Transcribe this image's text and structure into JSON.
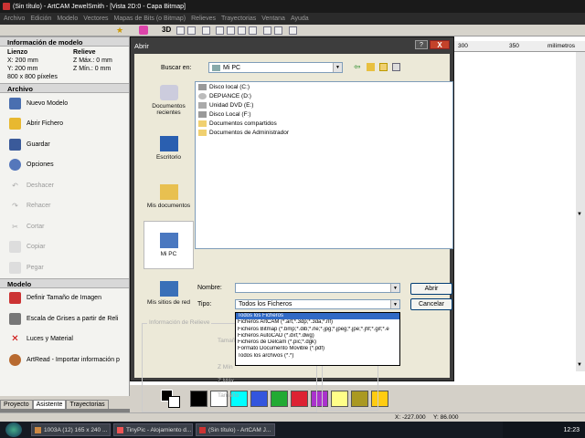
{
  "window": {
    "title": "(Sin título) - ArtCAM JewelSmith - [Vista 2D:0 - Capa Bitmap]"
  },
  "menu": [
    "Archivo",
    "Edición",
    "Modelo",
    "Vectores",
    "Mapas de Bits (o Bitmap)",
    "Relieves",
    "Trayectorias",
    "Ventana",
    "Ayuda"
  ],
  "toolbar": {
    "view3d": "3D"
  },
  "ruler": {
    "ticks": [
      "300",
      "350"
    ],
    "unit": "milímetros"
  },
  "panel": {
    "info_title": "Información de modelo",
    "lienzo_label": "Lienzo",
    "relieve_label": "Relieve",
    "x_size": "X: 200 mm",
    "y_size": "Y: 200 mm",
    "z_max": "Z Máx.: 0 mm",
    "z_min": "Z Mín.: 0 mm",
    "pixels": "800 x 800 píxeles",
    "archivo_title": "Archivo",
    "archivo_items": [
      {
        "label": "Nuevo Modelo",
        "enabled": true,
        "icon": "new-model-icon"
      },
      {
        "label": "Abrir Fichero",
        "enabled": true,
        "icon": "folder-open-icon"
      },
      {
        "label": "Guardar",
        "enabled": true,
        "icon": "save-icon"
      },
      {
        "label": "Opciones",
        "enabled": true,
        "icon": "options-icon"
      },
      {
        "label": "Deshacer",
        "enabled": false,
        "icon": "undo-icon"
      },
      {
        "label": "Rehacer",
        "enabled": false,
        "icon": "redo-icon"
      },
      {
        "label": "Cortar",
        "enabled": false,
        "icon": "cut-icon"
      },
      {
        "label": "Copiar",
        "enabled": false,
        "icon": "copy-icon"
      },
      {
        "label": "Pegar",
        "enabled": false,
        "icon": "paste-icon"
      }
    ],
    "modelo_title": "Modelo",
    "modelo_items": [
      {
        "label": "Definir Tamaño de Imagen",
        "icon": "image-size-icon"
      },
      {
        "label": "Escala de Grises a partir de Reli",
        "icon": "grayscale-icon"
      },
      {
        "label": "Luces y Material",
        "icon": "lights-icon"
      },
      {
        "label": "ArtRead - Importar información p",
        "icon": "artread-icon"
      }
    ],
    "tabs": [
      "Proyecto",
      "Asistente",
      "Trayectorias"
    ]
  },
  "dialog": {
    "title": "Abrir",
    "help": "?",
    "close": "X",
    "lookin_label": "Buscar en:",
    "lookin_value": "Mi PC",
    "places": [
      {
        "label": "Documentos recientes",
        "icon": "recent-docs-icon"
      },
      {
        "label": "Escritorio",
        "icon": "desktop-icon"
      },
      {
        "label": "Mis documentos",
        "icon": "my-documents-icon"
      },
      {
        "label": "Mi PC",
        "icon": "my-computer-icon",
        "selected": true
      },
      {
        "label": "Mis sitios de red",
        "icon": "network-places-icon"
      }
    ],
    "files": [
      {
        "label": "Disco local (C:)",
        "icon": "drive-icon"
      },
      {
        "label": "DEPIANCE (D:)",
        "icon": "cd-drive-icon"
      },
      {
        "label": "Unidad DVD (E:)",
        "icon": "dvd-drive-icon"
      },
      {
        "label": "Disco Local (F:)",
        "icon": "drive-icon"
      },
      {
        "label": "Documentos compartidos",
        "icon": "folder-icon"
      },
      {
        "label": "Documentos de Administrador",
        "icon": "folder-icon"
      }
    ],
    "name_label": "Nombre:",
    "name_value": "",
    "type_label": "Tipo:",
    "type_value": "Todos los Ficheros",
    "type_options": [
      "Todos los Ficheros",
      "Ficheros ArtCAM (*.art;*.3dp;*.3da;*.rlf)",
      "Ficheros Bitmap (*.bmp;*.dib;*.rle;*.jpg;*.jpeg;*.jpe;*.jfif;*.gif;*.e",
      "Ficheros AutoCAD (*.dxf;*.dwg)",
      "Ficheros de Delcam (*.pic;*.dgk)",
      "Formato Documento Movible (*.pdf)",
      "Todos los archivos (*.*)"
    ],
    "open_button": "Abrir",
    "cancel_button": "Cancelar",
    "relieve_group": "Información de Relieve",
    "relieve_fields": [
      "Tamaño",
      "Z Mín",
      "Z Máx",
      "Tamaño"
    ]
  },
  "palette": [
    "#000000",
    "#ffffff",
    "#00ffff",
    "#3355dd",
    "#22aa33",
    "#dd2233",
    "#aa33cc",
    "#ffff88",
    "#aa9922",
    "#ffcc11"
  ],
  "status": {
    "x": "X: -227.000",
    "y": "Y: 86.000"
  },
  "taskbar": {
    "tasks": [
      "1003A (12) 165 x 240 ...",
      "TinyPic - Alojamiento d...",
      "(Sin título) - ArtCAM J..."
    ],
    "clock": "12:23"
  }
}
